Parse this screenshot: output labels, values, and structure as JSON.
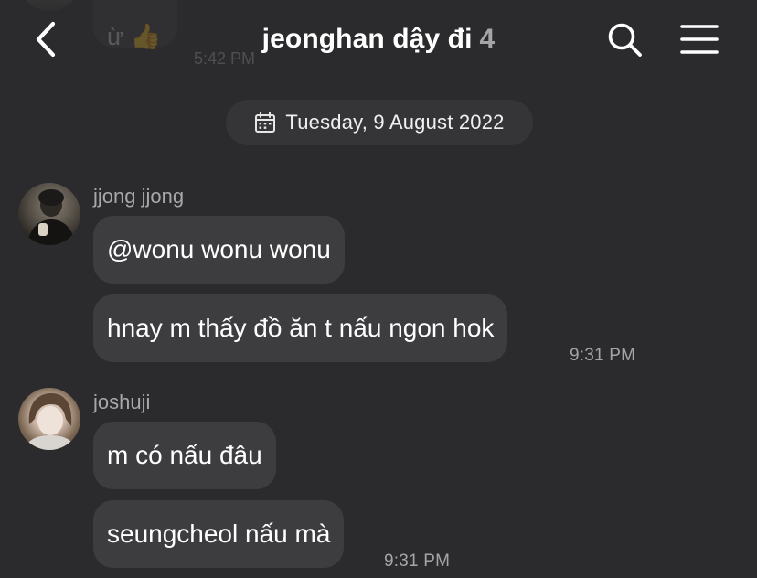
{
  "header": {
    "title": "jeonghan dậy đi",
    "member_count": "4"
  },
  "previous_message": {
    "text": "ừ 👍",
    "time": "5:42 PM"
  },
  "date_separator": "Tuesday, 9 August 2022",
  "groups": [
    {
      "sender": "jjong jjong",
      "messages": [
        "@wonu wonu wonu",
        "hnay m thấy đồ ăn t nấu ngon hok"
      ],
      "time": "9:31 PM"
    },
    {
      "sender": "joshuji",
      "messages": [
        "m có nấu đâu",
        "seungcheol nấu mà"
      ],
      "time": "9:31 PM"
    }
  ],
  "icons": {
    "back": "chevron-left-icon",
    "search": "search-icon",
    "menu": "hamburger-menu-icon",
    "date": "calendar-icon"
  },
  "colors": {
    "background": "#2b2b2d",
    "bubble": "#3d3d40",
    "date_pill": "#353538",
    "muted_text": "#a5a5a8"
  }
}
